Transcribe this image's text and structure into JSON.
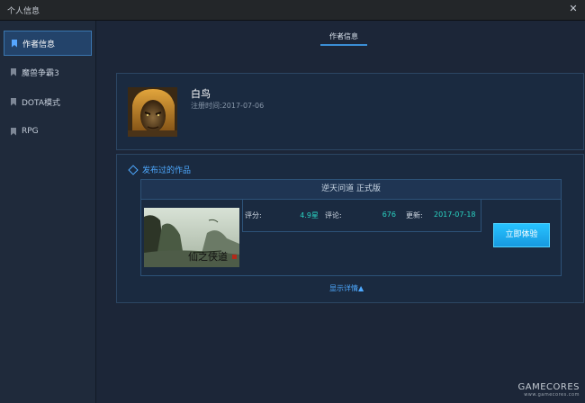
{
  "window": {
    "title": "个人信息",
    "close_icon": "close-icon"
  },
  "sidebar": {
    "items": [
      {
        "label": "作者信息",
        "icon": "bookmark-icon",
        "active": true
      },
      {
        "label": "魔兽争霸3",
        "icon": "bookmark-icon",
        "active": false
      },
      {
        "label": "DOTA模式",
        "icon": "bookmark-icon",
        "active": false
      },
      {
        "label": "RPG",
        "icon": "bookmark-icon",
        "active": false
      }
    ]
  },
  "main": {
    "tab": "作者信息",
    "profile": {
      "name": "白鸟",
      "registered": "注册时间:2017-07-06"
    },
    "works": {
      "title": "发布过的作品",
      "game": {
        "name": "逆天问道 正式版",
        "rating_label": "评分:",
        "rating_value": "4.9星",
        "reviews_label": "评论:",
        "reviews_value": "676",
        "updated_label": "更新:",
        "updated_value": "2017-07-18",
        "play_button": "立即体验"
      },
      "details_link": "显示详情▲"
    }
  },
  "watermark": {
    "main": "GAMECORES",
    "sub": "www.gamecores.com"
  },
  "colors": {
    "accent": "#4ea9ff",
    "value": "#2ad3c2",
    "button": "#1fb0f2"
  }
}
